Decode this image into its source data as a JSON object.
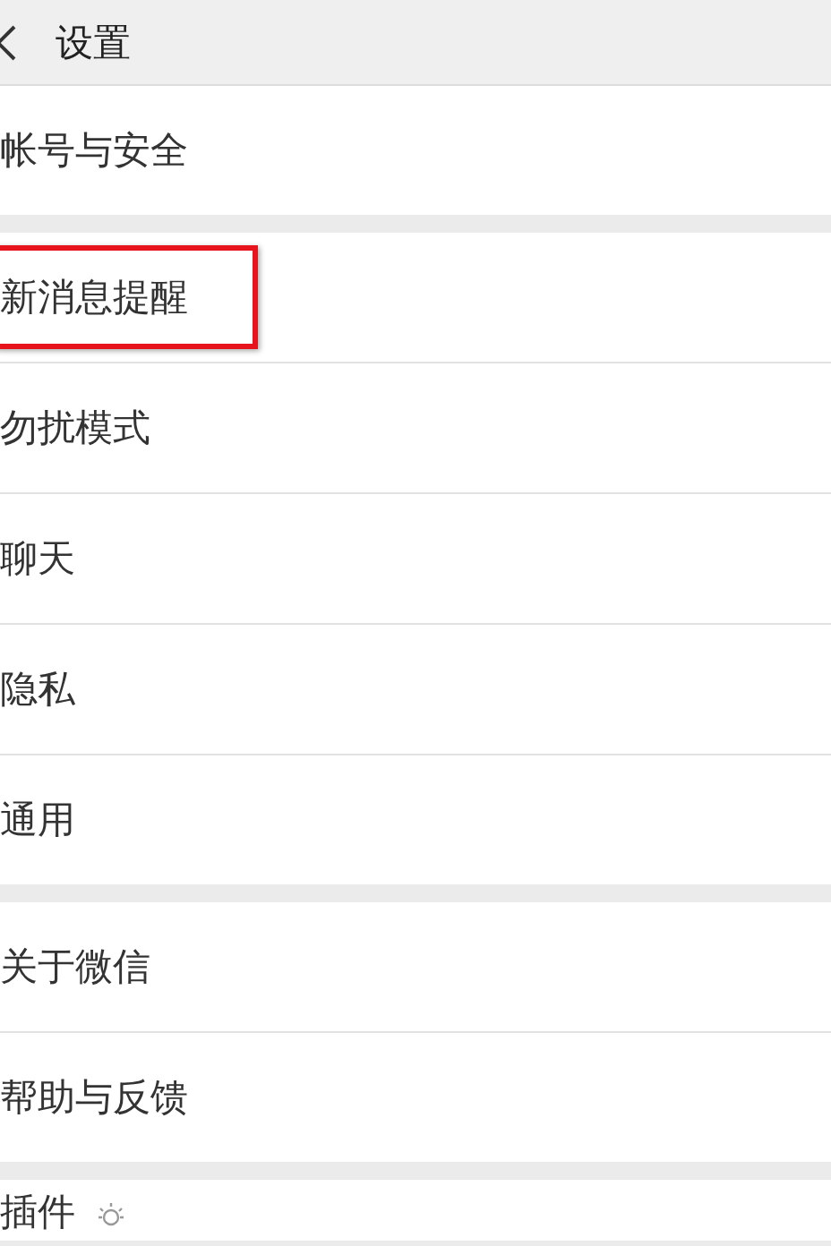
{
  "header": {
    "title": "设置"
  },
  "groups": [
    {
      "items": [
        {
          "label": "帐号与安全",
          "highlighted": false,
          "icon": false
        }
      ]
    },
    {
      "items": [
        {
          "label": "新消息提醒",
          "highlighted": true,
          "icon": false
        },
        {
          "label": "勿扰模式",
          "highlighted": false,
          "icon": false
        },
        {
          "label": "聊天",
          "highlighted": false,
          "icon": false
        },
        {
          "label": "隐私",
          "highlighted": false,
          "icon": false
        },
        {
          "label": "通用",
          "highlighted": false,
          "icon": false
        }
      ]
    },
    {
      "items": [
        {
          "label": "关于微信",
          "highlighted": false,
          "icon": false
        },
        {
          "label": "帮助与反馈",
          "highlighted": false,
          "icon": false
        }
      ]
    },
    {
      "items": [
        {
          "label": "插件",
          "highlighted": false,
          "icon": true
        }
      ]
    }
  ]
}
